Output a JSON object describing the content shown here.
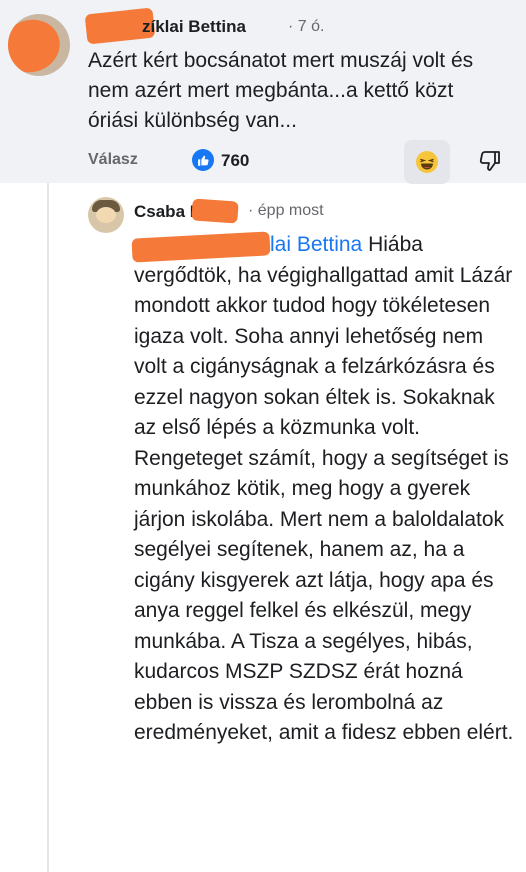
{
  "top_comment": {
    "author_visible": "zíklai Bettina",
    "time": "7 ó.",
    "text": "Azért kért bocsánatot mert muszáj volt és nem azért mert megbánta...a kettő közt óriási különbség van...",
    "reply_label": "Válasz",
    "like_count": "760",
    "like_icon": "thumbs-up-icon",
    "reaction_icon": "laughing-emoji-icon",
    "dislike_icon": "thumbs-down-icon"
  },
  "reply_comment": {
    "author_visible": "Csaba P",
    "time": "épp most",
    "mention_visible": "lai Bettina",
    "text": " Hiába vergődtök, ha végighallgattad amit Lázár mondott akkor tudod hogy tökéletesen igaza volt. Soha annyi lehetőség nem volt a cigányságnak a felzárkózásra és ezzel nagyon sokan éltek is. Sokaknak az első lépés a közmunka volt. Rengeteget számít, hogy a segítséget is munkához kötik, meg hogy a gyerek járjon iskolába. Mert nem a baloldalatok segélyei segítenek, hanem az, ha a cigány kisgyerek azt látja, hogy apa és anya reggel felkel és elkészül, megy munkába. A Tisza a segélyes, hibás, kudarcos MSZP SZDSZ érát hozná ebben is vissza és lerombolná az eredményeket, amit a fidesz ebben elért."
  },
  "colors": {
    "accent": "#1877f2",
    "redaction": "#f57a3a",
    "muted_text": "#65676b",
    "top_bg": "#f0f2f5"
  }
}
